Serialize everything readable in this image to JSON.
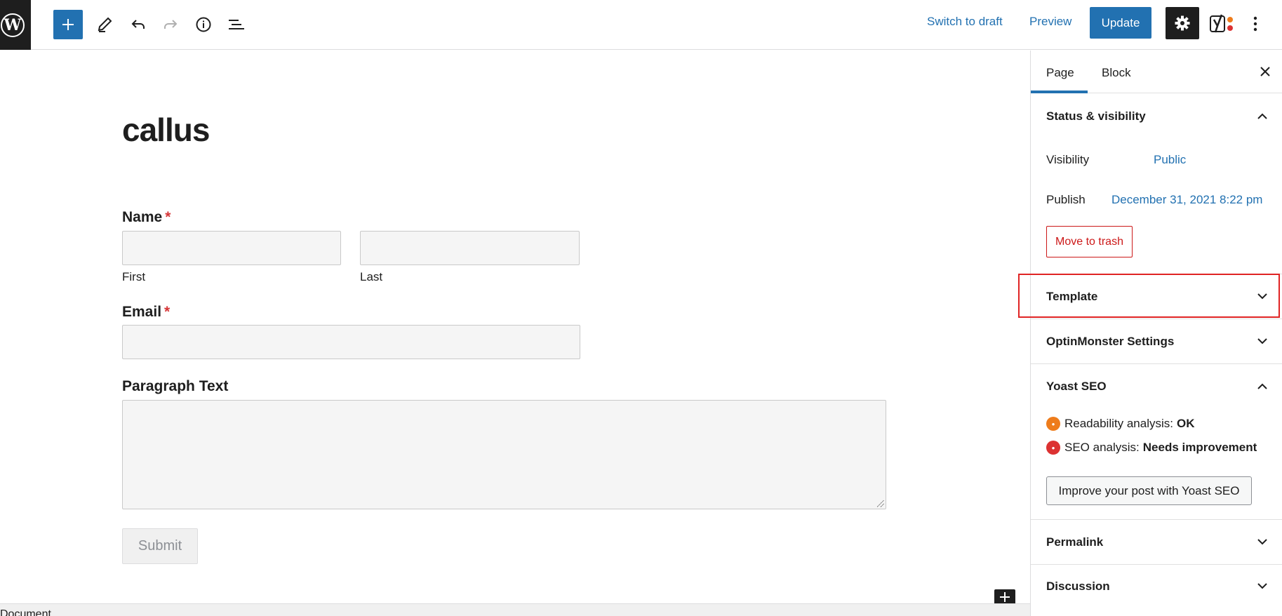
{
  "toolbar": {
    "logo_glyph": "W",
    "add_glyph": "+",
    "switch_to_draft": "Switch to draft",
    "preview": "Preview",
    "update": "Update",
    "accent_color": "#2271b1"
  },
  "editor": {
    "title": "callus",
    "fields": {
      "name_label": "Name",
      "required_mark": "*",
      "first_label": "First",
      "last_label": "Last",
      "email_label": "Email",
      "paragraph_label": "Paragraph Text"
    },
    "submit_label": "Submit"
  },
  "footer": {
    "breadcrumb": "Document"
  },
  "sidebar": {
    "tabs": [
      {
        "label": "Page",
        "active": true
      },
      {
        "label": "Block",
        "active": false
      }
    ],
    "status": {
      "title": "Status & visibility",
      "visibility_label": "Visibility",
      "visibility_value": "Public",
      "publish_label": "Publish",
      "publish_value": "December 31, 2021 8:22 pm",
      "trash_label": "Move to trash"
    },
    "template_title": "Template",
    "optinmonster_title": "OptinMonster Settings",
    "yoast": {
      "title": "Yoast SEO",
      "readability_label": "Readability analysis:",
      "readability_value": "OK",
      "seo_label": "SEO analysis:",
      "seo_value": "Needs improvement",
      "button_label": "Improve your post with Yoast SEO"
    },
    "permalink_title": "Permalink",
    "discussion_title": "Discussion"
  }
}
